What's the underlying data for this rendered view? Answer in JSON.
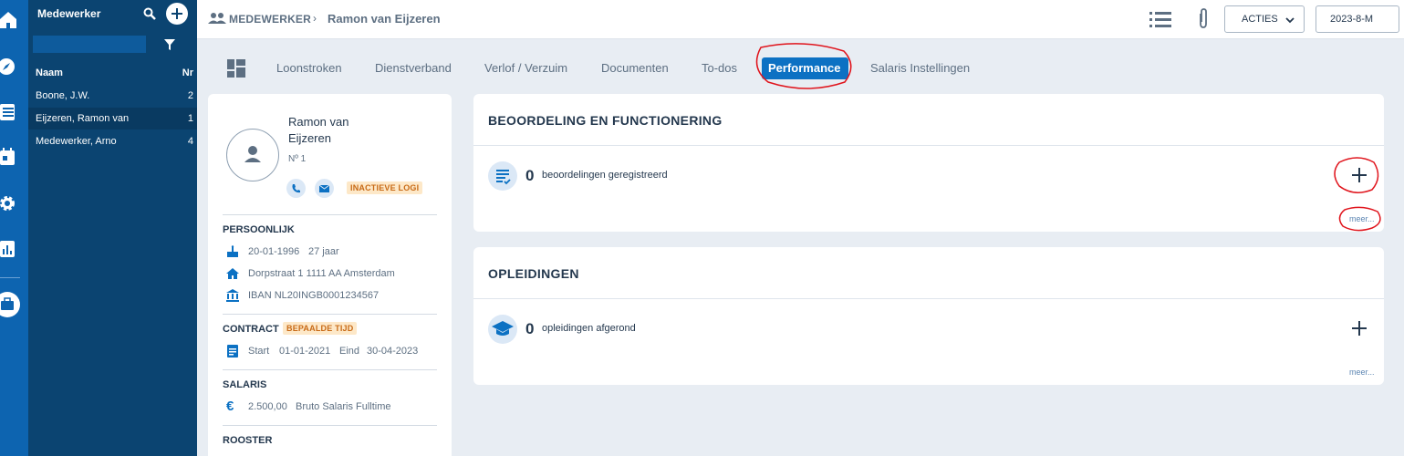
{
  "nav_rail": {
    "icons": [
      "home-icon",
      "compass-icon",
      "list-icon",
      "calendar-icon",
      "gear-icon",
      "chart-icon",
      "briefcase-icon"
    ]
  },
  "employee_list": {
    "title": "Medewerker",
    "columns": {
      "name": "Naam",
      "nr": "Nr"
    },
    "rows": [
      {
        "name": "Boone, J.W.",
        "nr": "2",
        "active": false
      },
      {
        "name": "Eijzeren, Ramon van",
        "nr": "1",
        "active": true
      },
      {
        "name": "Medewerker, Arno",
        "nr": "4",
        "active": false
      }
    ]
  },
  "topbar": {
    "breadcrumb_root": "MEDEWERKER",
    "breadcrumb_current": "Ramon van Eijzeren",
    "acties_label": "ACTIES",
    "period_label": "2023-8-M"
  },
  "tabs": {
    "items": [
      "Loonstroken",
      "Dienstverband",
      "Verlof / Verzuim",
      "Documenten",
      "To-dos",
      "Performance",
      "Salaris Instellingen"
    ],
    "active": "Performance"
  },
  "profile": {
    "name_line1": "Ramon van",
    "name_line2": "Eijzeren",
    "number": "Nº 1",
    "login_badge": "INACTIEVE LOGI",
    "persoonlijk_title": "PERSOONLIJK",
    "birth_date": "20-01-1996",
    "age": "27 jaar",
    "address": "Dorpstraat 1 1111 AA Amsterdam",
    "iban": "IBAN NL20INGB0001234567",
    "contract_title": "CONTRACT",
    "contract_badge": "BEPAALDE TIJD",
    "start_label": "Start",
    "start_date": "01-01-2021",
    "end_label": "Eind",
    "end_date": "30-04-2023",
    "salaris_title": "SALARIS",
    "salary": "2.500,00",
    "salary_desc": "Bruto Salaris Fulltime",
    "rooster_title": "ROOSTER"
  },
  "beoordeling": {
    "title": "BEOORDELING EN FUNCTIONERING",
    "count": "0",
    "label": "beoordelingen geregistreerd",
    "more": "meer..."
  },
  "opleidingen": {
    "title": "OPLEIDINGEN",
    "count": "0",
    "label": "opleidingen afgerond",
    "more": "meer..."
  },
  "colors": {
    "rail": "#0d64b0",
    "list_panel": "#0b4471",
    "accent": "#0c71c3",
    "annotation": "#e0141c"
  }
}
